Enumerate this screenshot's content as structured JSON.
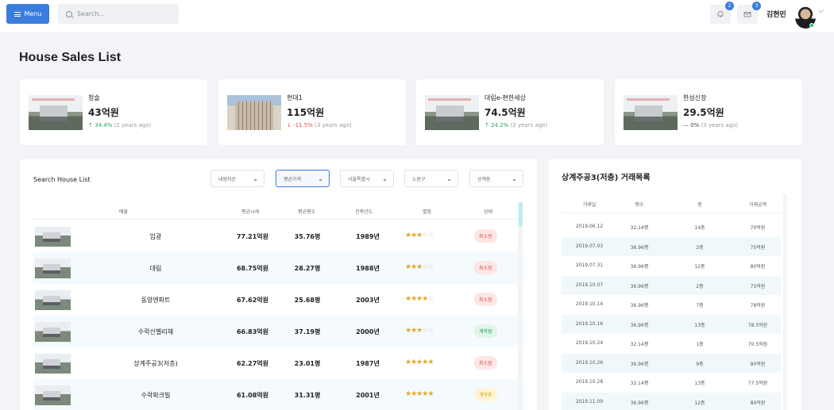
{
  "topbar": {
    "menu_label": "Menu",
    "search_placeholder": "Search...",
    "notif_count": "2",
    "mail_count": "3",
    "user_name": "김현민"
  },
  "page_title": "House Sales List",
  "cards": [
    {
      "name": "청솔",
      "price": "43억원",
      "change": "↑ 34.4%",
      "period": "(2 years ago)",
      "trend": "up"
    },
    {
      "name": "현대1",
      "price": "115억원",
      "change": "↓ -11.5%",
      "period": "(3 years ago)",
      "trend": "down"
    },
    {
      "name": "대림e-편한세상",
      "price": "74.5억원",
      "change": "↑ 24.2%",
      "period": "(2 years ago)",
      "trend": "up"
    },
    {
      "name": "한성신장",
      "price": "29.5억원",
      "change": "— 0%",
      "period": "(3 years ago)",
      "trend": "flat"
    }
  ],
  "search_panel": {
    "title": "Search House List",
    "filters": [
      "내림차순",
      "평균가격",
      "서울특별시",
      "노원구",
      "상계동"
    ],
    "columns": [
      "매물",
      "평균시세",
      "평균평수",
      "건축년도",
      "별점",
      "상태"
    ],
    "rows": [
      {
        "name": "임광",
        "avg_price": "77.21억원",
        "avg_size": "35.76평",
        "year": "1989년",
        "stars": 3,
        "status": "취소됨",
        "status_type": "cancel"
      },
      {
        "name": "대림",
        "avg_price": "68.75억원",
        "avg_size": "28.27평",
        "year": "1988년",
        "stars": 3,
        "status": "취소됨",
        "status_type": "cancel"
      },
      {
        "name": "동양엔파트",
        "avg_price": "67.62억원",
        "avg_size": "25.68평",
        "year": "2003년",
        "stars": 4,
        "status": "취소됨",
        "status_type": "cancel"
      },
      {
        "name": "수락신벨리채",
        "avg_price": "66.83억원",
        "avg_size": "37.19평",
        "year": "2000년",
        "stars": 3,
        "status": "계약됨",
        "status_type": "contract"
      },
      {
        "name": "상계주공3(저층)",
        "avg_price": "62.27억원",
        "avg_size": "23.01평",
        "year": "1987년",
        "stars": 5,
        "status": "취소됨",
        "status_type": "cancel"
      },
      {
        "name": "수락파크빌",
        "avg_price": "61.08억원",
        "avg_size": "31.31평",
        "year": "2001년",
        "stars": 5,
        "status": "계약중",
        "status_type": "pending"
      }
    ]
  },
  "trade_panel": {
    "title": "상계주공3(저층) 거래목록",
    "columns": [
      "거래일",
      "평수",
      "층",
      "거래금액"
    ],
    "rows": [
      [
        "2019.06.12",
        "32.14평",
        "14층",
        "70억원"
      ],
      [
        "2019.07.03",
        "36.96평",
        "2층",
        "75억원"
      ],
      [
        "2019.07.31",
        "36.96평",
        "12층",
        "80억원"
      ],
      [
        "2019.10.07",
        "36.96평",
        "2층",
        "75억원"
      ],
      [
        "2019.10.14",
        "36.96평",
        "7층",
        "78억원"
      ],
      [
        "2019.10.16",
        "36.96평",
        "13층",
        "78.5억원"
      ],
      [
        "2019.10.24",
        "32.14평",
        "1층",
        "70.5억원"
      ],
      [
        "2019.10.26",
        "36.96평",
        "9층",
        "80억원"
      ],
      [
        "2019.10.28",
        "32.14평",
        "13층",
        "77.5억원"
      ],
      [
        "2019.11.09",
        "36.96평",
        "12층",
        "84억원"
      ]
    ]
  }
}
